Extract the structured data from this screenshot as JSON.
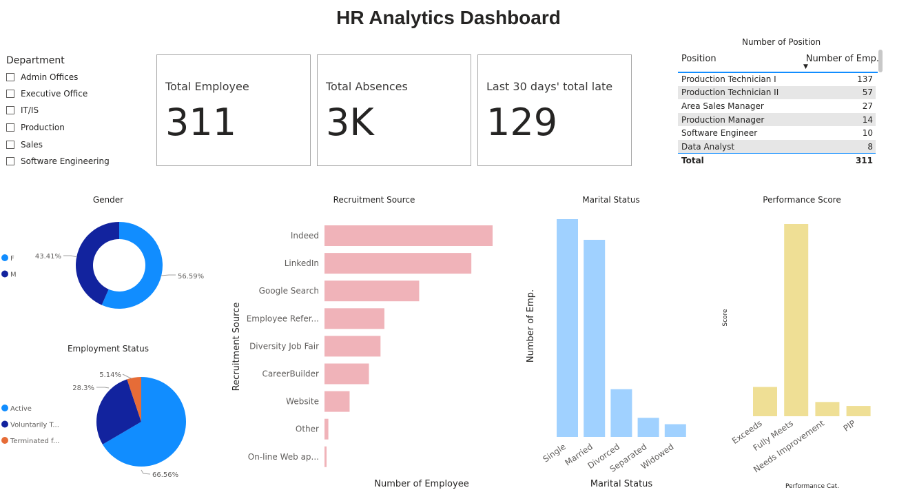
{
  "title": "HR Analytics Dashboard",
  "slicer": {
    "title": "Department",
    "items": [
      "Admin Offices",
      "Executive Office",
      "IT/IS",
      "Production",
      "Sales",
      "Software Engineering"
    ]
  },
  "cards": [
    {
      "label": "Total Employee",
      "value": "311"
    },
    {
      "label": "Total Absences",
      "value": "3K"
    },
    {
      "label": "Last 30 days' total late",
      "value": "129"
    }
  ],
  "position_table": {
    "title": "Number of Position",
    "col_position": "Position",
    "col_count": "Number of Emp.",
    "rows": [
      {
        "position": "Production Technician I",
        "count": "137"
      },
      {
        "position": "Production Technician II",
        "count": "57"
      },
      {
        "position": "Area Sales Manager",
        "count": "27"
      },
      {
        "position": "Production Manager",
        "count": "14"
      },
      {
        "position": "Software Engineer",
        "count": "10"
      },
      {
        "position": "Data Analyst",
        "count": "8"
      }
    ],
    "total_label": "Total",
    "total_value": "311"
  },
  "colors": {
    "blue": "#118dff",
    "navy": "#12239e",
    "orange": "#e66c37",
    "pink": "#f0b3b9",
    "light_blue": "#a0d1ff",
    "yellow": "#efdf95"
  },
  "chart_data": [
    {
      "type": "pie",
      "donut": true,
      "title": "Gender",
      "legend": [
        "F",
        "M"
      ],
      "values": [
        56.59,
        43.41
      ],
      "data_labels": [
        "56.59%",
        "43.41%"
      ]
    },
    {
      "type": "pie",
      "title": "Employment Status",
      "legend": [
        "Active",
        "Voluntarily T...",
        "Terminated f..."
      ],
      "values": [
        66.56,
        28.3,
        5.14
      ],
      "data_labels": [
        "66.56%",
        "28.3%",
        "5.14%"
      ]
    },
    {
      "type": "bar",
      "orientation": "horizontal",
      "title": "Recruitment Source",
      "xlabel": "Number of Employee",
      "ylabel": "Recruitment Source",
      "categories": [
        "Indeed",
        "LinkedIn",
        "Google Search",
        "Employee Refer...",
        "Diversity Job Fair",
        "CareerBuilder",
        "Website",
        "Other",
        "On-line Web ap..."
      ],
      "values": [
        87,
        76,
        49,
        31,
        29,
        23,
        13,
        2,
        1
      ]
    },
    {
      "type": "bar",
      "title": "Marital Status",
      "xlabel": "Marital Status",
      "ylabel": "Number of Emp.",
      "categories": [
        "Single",
        "Married",
        "Divorced",
        "Separated",
        "Widowed"
      ],
      "values": [
        137,
        124,
        30,
        12,
        8
      ]
    },
    {
      "type": "bar",
      "title": "Performance Score",
      "xlabel": "Performance Cat.",
      "ylabel": "Score",
      "categories": [
        "Exceeds",
        "Fully Meets",
        "Needs Improvement",
        "PIP"
      ],
      "values": [
        37,
        243,
        18,
        13
      ]
    }
  ]
}
